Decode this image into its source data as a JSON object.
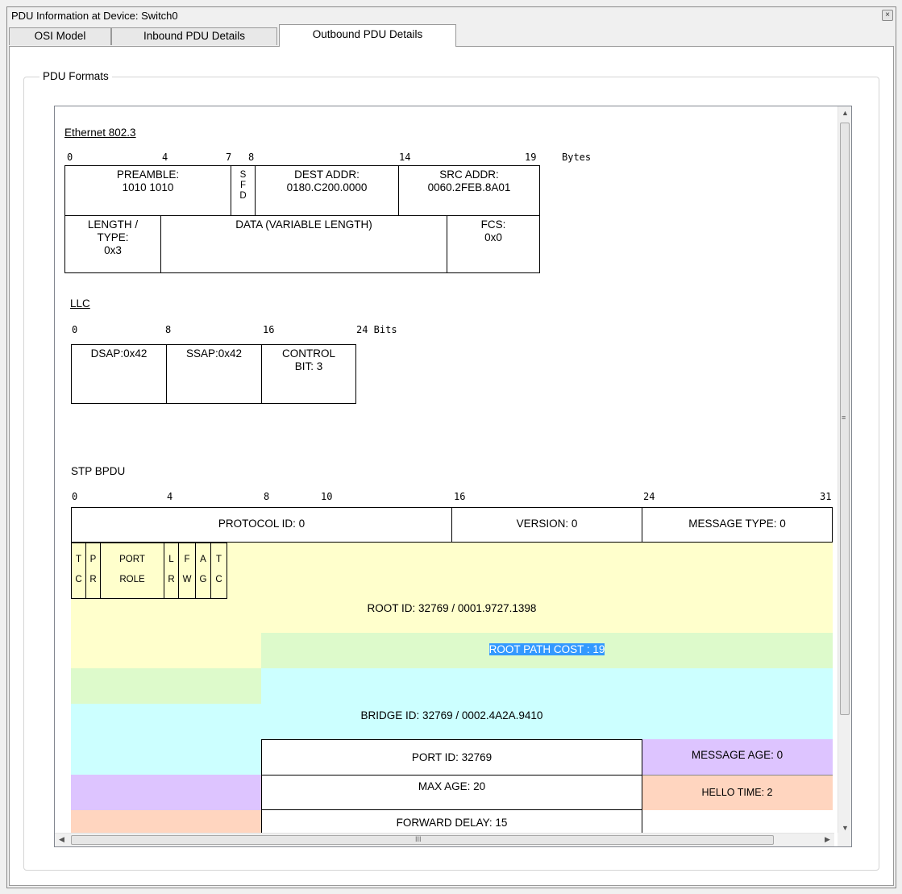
{
  "window": {
    "title": "PDU Information at Device: Switch0",
    "close_label": "×"
  },
  "tabs": [
    {
      "label": "OSI Model"
    },
    {
      "label": "Inbound PDU Details"
    },
    {
      "label": "Outbound PDU Details",
      "active": true
    }
  ],
  "groupbox": {
    "label": "PDU Formats"
  },
  "ethernet": {
    "title": "Ethernet 802.3",
    "ruler": [
      "0",
      "4",
      "7",
      "8",
      "14",
      "19",
      "Bytes"
    ],
    "preamble": {
      "label": "PREAMBLE:",
      "value": "1010 1010"
    },
    "sfd": [
      "S",
      "F",
      "D"
    ],
    "dest": {
      "label": "DEST ADDR:",
      "value": "0180.C200.0000"
    },
    "src": {
      "label": "SRC ADDR:",
      "value": "0060.2FEB.8A01"
    },
    "length": {
      "label1": "LENGTH /",
      "label2": "TYPE:",
      "value": "0x3"
    },
    "data": {
      "label": "DATA (VARIABLE LENGTH)"
    },
    "fcs": {
      "label": "FCS:",
      "value": "0x0"
    }
  },
  "llc": {
    "title": "LLC",
    "ruler": [
      "0",
      "8",
      "16",
      "24 Bits"
    ],
    "dsap": "DSAP:0x42",
    "ssap": "SSAP:0x42",
    "control": {
      "label": "CONTROL",
      "value": "BIT: 3"
    }
  },
  "stp": {
    "title": "STP BPDU",
    "ruler": [
      "0",
      "4",
      "8",
      "10",
      "16",
      "24",
      "31"
    ],
    "protocol_id": "PROTOCOL ID: 0",
    "version": "VERSION: 0",
    "message_type": "MESSAGE TYPE: 0",
    "flags": [
      {
        "top": "T",
        "bottom": "C"
      },
      {
        "top": "P",
        "bottom": "R"
      },
      {
        "top": "PORT",
        "bottom": "ROLE"
      },
      {
        "top": "L",
        "bottom": "R"
      },
      {
        "top": "F",
        "bottom": "W"
      },
      {
        "top": "A",
        "bottom": "G"
      },
      {
        "top": "T",
        "bottom": "C"
      }
    ],
    "root_id": "ROOT ID: 32769 / 0001.9727.1398",
    "root_path_cost": "ROOT PATH COST : 19",
    "bridge_id": "BRIDGE ID: 32769 / 0002.4A2A.9410",
    "port_id": "PORT ID: 32769",
    "message_age": "MESSAGE AGE: 0",
    "max_age": "MAX AGE: 20",
    "hello_time": "HELLO TIME: 2",
    "forward_delay": "FORWARD DELAY: 15"
  },
  "colors": {
    "root": "#ffffcc",
    "cost": "#ddfacb",
    "bridge": "#ccffff",
    "age": "#ddc4ff",
    "hello": "#ffd5bf",
    "selection": "#3399ff"
  },
  "scrollbars": {
    "h_grip": "III",
    "v_grip": "≡"
  }
}
